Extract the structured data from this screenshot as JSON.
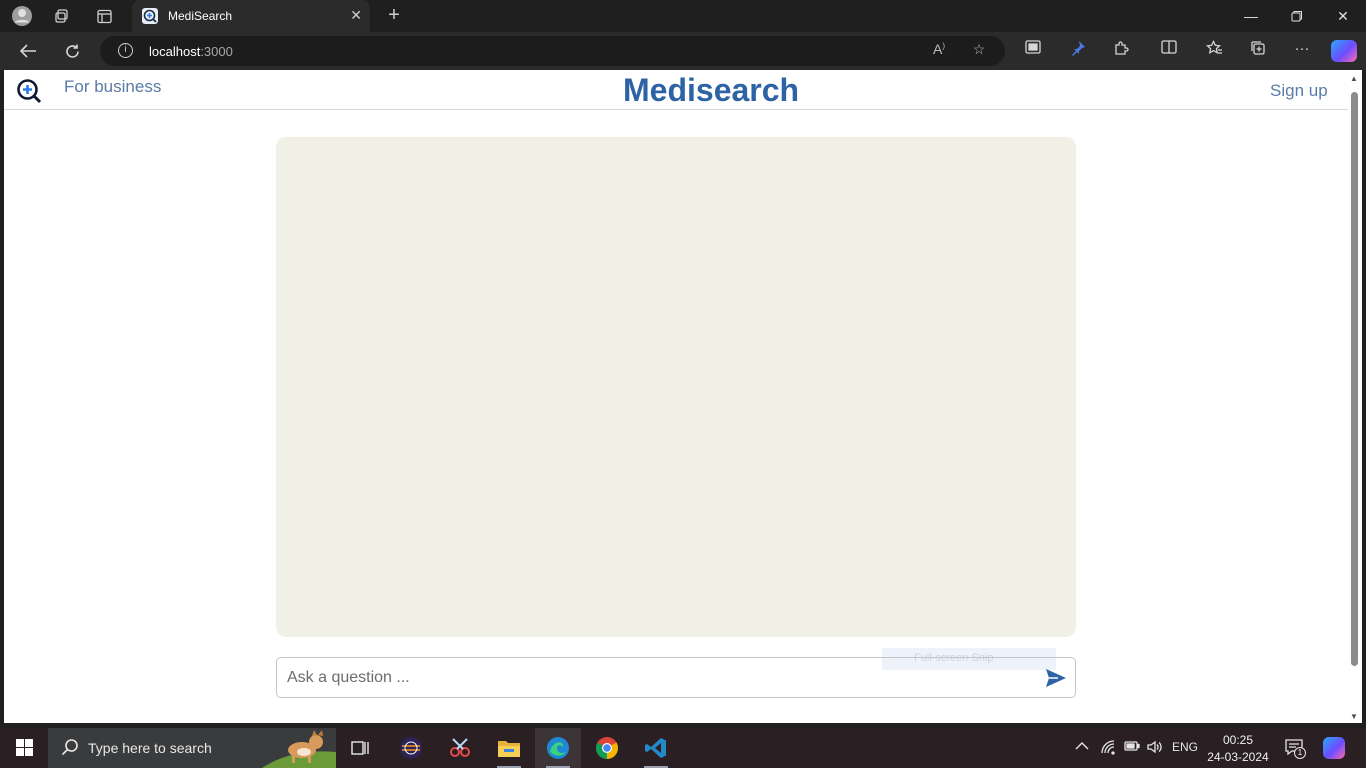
{
  "browser": {
    "tab_title": "MediSearch",
    "url_host": "localhost",
    "url_port": ":3000",
    "controls": [
      "profile-icon",
      "workspaces-icon",
      "vertical-tabs-icon",
      "new-tab-icon",
      "minimize-icon",
      "restore-icon",
      "close-icon"
    ]
  },
  "site": {
    "brand": "Medisearch",
    "for_business_label": "For business",
    "signup_label": "Sign up",
    "accent_color": "#2d63a5",
    "link_color": "#5a7ba6",
    "chat_bg_color": "#f0f0e6"
  },
  "chat": {
    "input_placeholder": "Ask a question ...",
    "input_value": ""
  },
  "overlay": {
    "snip_tooltip": "Full-screen Snip"
  },
  "taskbar": {
    "search_placeholder": "Type here to search",
    "apps": [
      "task-view-icon",
      "eclipse-icon",
      "snipping-tool-icon",
      "file-explorer-icon",
      "edge-icon",
      "chrome-icon",
      "vscode-icon"
    ],
    "language": "ENG",
    "time": "00:25",
    "date": "24-03-2024",
    "notification_count": "1"
  }
}
